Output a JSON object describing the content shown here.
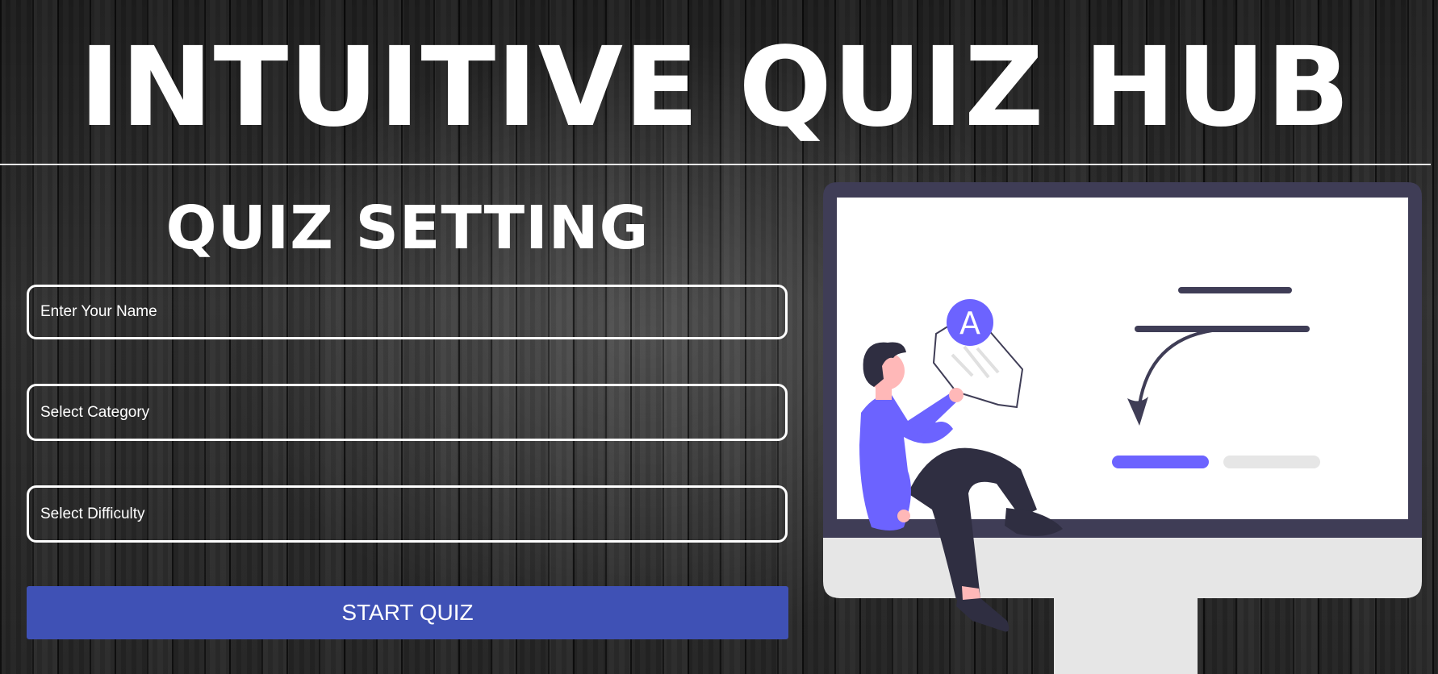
{
  "header": {
    "title": "INTUITIVE QUIZ HUB"
  },
  "settings": {
    "title": "QUIZ SETTING",
    "name_placeholder": "Enter Your Name",
    "category_label": "Select Category",
    "difficulty_label": "Select Difficulty",
    "start_label": "START QUIZ"
  },
  "illustration": {
    "badge_letter": "A",
    "icon": "person-with-quiz-paper-monitor-illustration",
    "colors": {
      "accent": "#6c63ff",
      "dark": "#3f3d56",
      "monitor_base": "#e6e6e6",
      "button": "#3f51b5"
    }
  }
}
